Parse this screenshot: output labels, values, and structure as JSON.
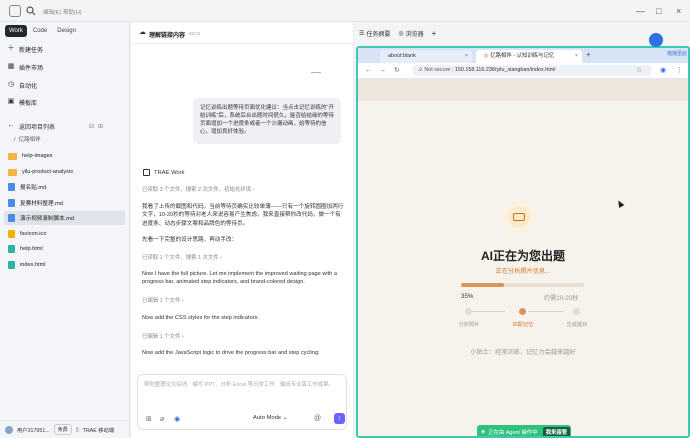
{
  "topbar": {
    "menu_edit": "编辑(E)",
    "menu_help": "帮助(H)"
  },
  "sidebar": {
    "modes": [
      "Work",
      "Code",
      "Design"
    ],
    "nav": [
      {
        "label": "新建任务",
        "icon": "plus-icon"
      },
      {
        "label": "插件市场",
        "icon": "grid-icon"
      },
      {
        "label": "自动化",
        "icon": "clock-icon"
      },
      {
        "label": "模板库",
        "icon": "template-icon"
      }
    ],
    "back_label": "返回项目列表",
    "crumb": "亿路相伴",
    "files": [
      {
        "name": "help-images",
        "kind": "folder"
      },
      {
        "name": "yilu-product-analysis",
        "kind": "folder"
      },
      {
        "name": "报名贴.md",
        "kind": "md"
      },
      {
        "name": "复赛材料整理.md",
        "kind": "md"
      },
      {
        "name": "演示视频录制脚本.md",
        "kind": "md"
      },
      {
        "name": "favicon.ico",
        "kind": "ico"
      },
      {
        "name": "help.html",
        "kind": "html"
      },
      {
        "name": "index.html",
        "kind": "html"
      }
    ],
    "user": {
      "name": "用户317951...",
      "plan": "免费",
      "badge": "TRAE 移动端"
    }
  },
  "chat": {
    "title": "理解链接内容",
    "time": "22:01",
    "user_message": "记忆训练出题等待页面优化建议：当点击记忆训练的“开始训练”后，系统后台出题时间很久，能否给结缘的等待页面增加一个进度条或者一个沙漏动画，给等待的信心，增加良好体验。",
    "agent_name": "TRAE Work",
    "meta1": "已读取 3 个文件，搜索 2 次文件，初始化环境",
    "para1": "我看了上传的截图和代码。当前等待页确实比较单薄——只有一个旋转圆圈加两行文字，10-20秒的等待对老人来说容易产生焦虑。我来直接帮你改代码，做一个有进度条、动态步骤文案和品牌色的等待页。",
    "para2": "先看一下完整的设计思路，再动手改：",
    "meta2": "已读取 1 个文件，搜索 1 次文件",
    "para3": "Now I have the full picture. Let me implement the improved waiting page with a progress bar, animated step indicators, and brand-colored design.",
    "meta3": "已编辑 1 个文件",
    "para4": "Now add the CSS styles for the step indicators:",
    "meta4": "已编辑 1 个文件",
    "para5": "Now add the JavaScript logic to drive the progress bar and step cycling:",
    "input_placeholder": "帮你整理论文综述、编写 PPT、分析 Excel 等日常工作、输出专业版工作成果。",
    "mode_label": "Auto Mode"
  },
  "rpanel": {
    "tab_tasks": "任务摘要",
    "tab_browser": "浏览器",
    "btab1": "about:blank",
    "btab2": "亿路相伴 - 认知训练与记忆",
    "addr_secure": "Not secure",
    "addr_url": "150.158.116.238/yilu_xiangban/index.html",
    "page": {
      "title": "AI正在为您出题",
      "subtitle": "正在分析照片信息...",
      "percent_text": "35%",
      "progress": 0.35,
      "eta": "约需10-20秒",
      "steps": [
        {
          "label": "分析照片",
          "state": "done"
        },
        {
          "label": "匹配记忆",
          "state": "active"
        },
        {
          "label": "生成题目",
          "state": "pending"
        }
      ],
      "tip": "小贴士：经常训练，记忆力会越来越好"
    },
    "agent_bar": {
      "text": "正在由 Agent 操作中",
      "takeover": "我来接管"
    }
  },
  "float_badge": {
    "label": "拖拽至此"
  },
  "colors": {
    "accent": "#6b63ff",
    "brand": "#d9945a",
    "browser_border": "#3fc7b1",
    "agent_green": "#2ec27e"
  }
}
